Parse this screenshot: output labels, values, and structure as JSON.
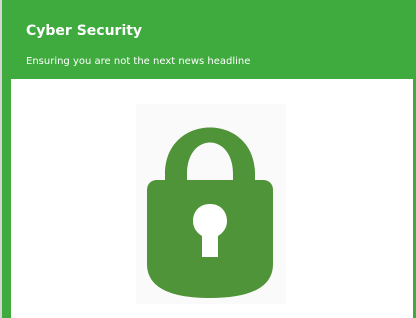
{
  "header": {
    "title": "Cyber Security",
    "subtitle": "Ensuring you are not the next news headline"
  },
  "colors": {
    "accent": "#3faa3e",
    "lock": "#4f9438"
  },
  "icons": {
    "main": "padlock-icon"
  }
}
